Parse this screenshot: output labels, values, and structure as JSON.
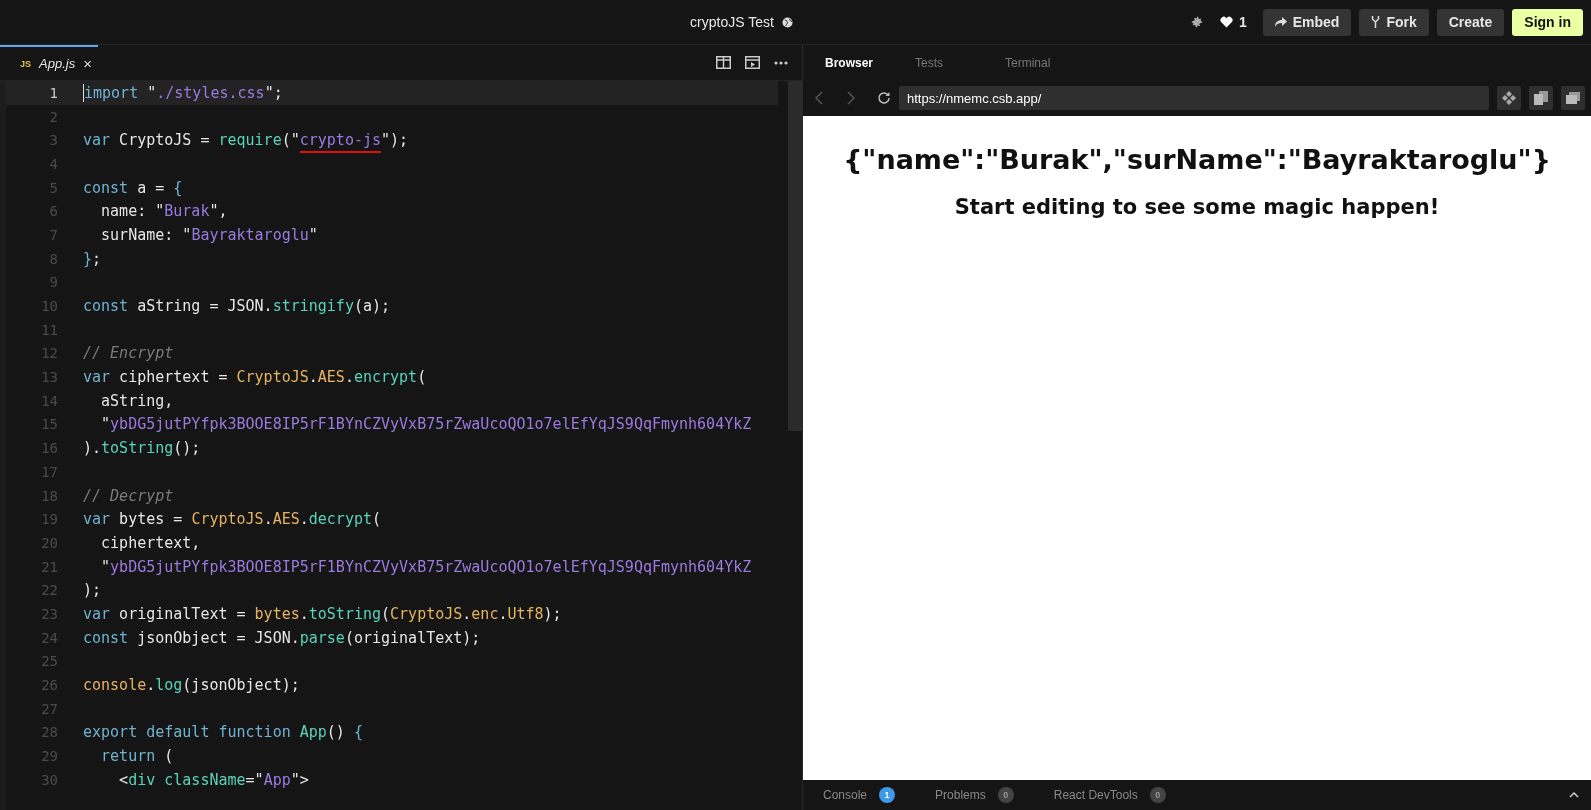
{
  "header": {
    "title": "cryptoJS Test",
    "likes": "1",
    "buttons": [
      {
        "label": "Embed",
        "kind": "share"
      },
      {
        "label": "Fork",
        "kind": "fork"
      },
      {
        "label": "Create",
        "kind": "plain"
      },
      {
        "label": "Sign in",
        "kind": "primary"
      }
    ]
  },
  "editor": {
    "tabs": [
      {
        "badge": "JS",
        "label": "App.js",
        "selected": true,
        "close": "×"
      }
    ],
    "lines": [
      {
        "number": "1",
        "active": true,
        "tokens": [
          {
            "kind": "kw",
            "text": "import"
          },
          {
            "kind": "p",
            "text": " \""
          },
          {
            "kind": "str",
            "text": "./styles.css"
          },
          {
            "kind": "p",
            "text": "\";"
          }
        ]
      },
      {
        "number": "2",
        "active": false
      },
      {
        "number": "3",
        "active": false,
        "tokens": [
          {
            "kind": "kw",
            "text": "var"
          },
          {
            "kind": "p",
            "text": " CryptoJS = "
          },
          {
            "kind": "fn",
            "text": "require"
          },
          {
            "kind": "p",
            "text": "(\""
          },
          {
            "kind": "err",
            "text": "crypto-js"
          },
          {
            "kind": "p",
            "text": "\");"
          }
        ]
      },
      {
        "number": "4",
        "active": false
      },
      {
        "number": "5",
        "active": false,
        "tokens": [
          {
            "kind": "kw",
            "text": "const"
          },
          {
            "kind": "p",
            "text": " a = "
          },
          {
            "kind": "kw",
            "text": "{"
          }
        ]
      },
      {
        "number": "6",
        "active": false,
        "tokens": [
          {
            "kind": "p",
            "text": "  name: \""
          },
          {
            "kind": "str",
            "text": "Burak"
          },
          {
            "kind": "p",
            "text": "\","
          }
        ]
      },
      {
        "number": "7",
        "active": false,
        "tokens": [
          {
            "kind": "p",
            "text": "  surName: \""
          },
          {
            "kind": "str",
            "text": "Bayraktaroglu"
          },
          {
            "kind": "p",
            "text": "\""
          }
        ]
      },
      {
        "number": "8",
        "active": false,
        "tokens": [
          {
            "kind": "kw",
            "text": "}"
          },
          {
            "kind": "p",
            "text": ";"
          }
        ]
      },
      {
        "number": "9",
        "active": false
      },
      {
        "number": "10",
        "active": false,
        "tokens": [
          {
            "kind": "kw",
            "text": "const"
          },
          {
            "kind": "p",
            "text": " aString = JSON."
          },
          {
            "kind": "fn",
            "text": "stringify"
          },
          {
            "kind": "p",
            "text": "(a);"
          }
        ]
      },
      {
        "number": "11",
        "active": false
      },
      {
        "number": "12",
        "active": false,
        "tokens": [
          {
            "kind": "cmt",
            "text": "// Encrypt"
          }
        ]
      },
      {
        "number": "13",
        "active": false,
        "tokens": [
          {
            "kind": "kw",
            "text": "var"
          },
          {
            "kind": "p",
            "text": " ciphertext = "
          },
          {
            "kind": "obj",
            "text": "CryptoJS"
          },
          {
            "kind": "p",
            "text": "."
          },
          {
            "kind": "obj",
            "text": "AES"
          },
          {
            "kind": "p",
            "text": "."
          },
          {
            "kind": "fn",
            "text": "encrypt"
          },
          {
            "kind": "p",
            "text": "("
          }
        ]
      },
      {
        "number": "14",
        "active": false,
        "tokens": [
          {
            "kind": "p",
            "text": "  aString,"
          }
        ]
      },
      {
        "number": "15",
        "active": false,
        "tokens": [
          {
            "kind": "p",
            "text": "  \""
          },
          {
            "kind": "str",
            "text": "ybDG5jutPYfpk3BOOE8IP5rF1BYnCZVyVxB75rZwaUcoQO1o7elEfYqJS9QqFmynh604YkZ"
          }
        ]
      },
      {
        "number": "16",
        "active": false,
        "tokens": [
          {
            "kind": "p",
            "text": ")."
          },
          {
            "kind": "fn",
            "text": "toString"
          },
          {
            "kind": "p",
            "text": "();"
          }
        ]
      },
      {
        "number": "17",
        "active": false
      },
      {
        "number": "18",
        "active": false,
        "tokens": [
          {
            "kind": "cmt",
            "text": "// Decrypt"
          }
        ]
      },
      {
        "number": "19",
        "active": false,
        "tokens": [
          {
            "kind": "kw",
            "text": "var"
          },
          {
            "kind": "p",
            "text": " bytes = "
          },
          {
            "kind": "obj",
            "text": "CryptoJS"
          },
          {
            "kind": "p",
            "text": "."
          },
          {
            "kind": "obj",
            "text": "AES"
          },
          {
            "kind": "p",
            "text": "."
          },
          {
            "kind": "fn",
            "text": "decrypt"
          },
          {
            "kind": "p",
            "text": "("
          }
        ]
      },
      {
        "number": "20",
        "active": false,
        "tokens": [
          {
            "kind": "p",
            "text": "  ciphertext,"
          }
        ]
      },
      {
        "number": "21",
        "active": false,
        "tokens": [
          {
            "kind": "p",
            "text": "  \""
          },
          {
            "kind": "str",
            "text": "ybDG5jutPYfpk3BOOE8IP5rF1BYnCZVyVxB75rZwaUcoQO1o7elEfYqJS9QqFmynh604YkZ"
          }
        ]
      },
      {
        "number": "22",
        "active": false,
        "tokens": [
          {
            "kind": "p",
            "text": ");"
          }
        ]
      },
      {
        "number": "23",
        "active": false,
        "tokens": [
          {
            "kind": "kw",
            "text": "var"
          },
          {
            "kind": "p",
            "text": " originalText = "
          },
          {
            "kind": "obj",
            "text": "bytes"
          },
          {
            "kind": "p",
            "text": "."
          },
          {
            "kind": "fn",
            "text": "toString"
          },
          {
            "kind": "p",
            "text": "("
          },
          {
            "kind": "obj",
            "text": "CryptoJS"
          },
          {
            "kind": "p",
            "text": "."
          },
          {
            "kind": "obj",
            "text": "enc"
          },
          {
            "kind": "p",
            "text": "."
          },
          {
            "kind": "obj",
            "text": "Utf8"
          },
          {
            "kind": "p",
            "text": ");"
          }
        ]
      },
      {
        "number": "24",
        "active": false,
        "tokens": [
          {
            "kind": "kw",
            "text": "const"
          },
          {
            "kind": "p",
            "text": " jsonObject = JSON."
          },
          {
            "kind": "fn",
            "text": "parse"
          },
          {
            "kind": "p",
            "text": "(originalText);"
          }
        ]
      },
      {
        "number": "25",
        "active": false
      },
      {
        "number": "26",
        "active": false,
        "tokens": [
          {
            "kind": "obj",
            "text": "console"
          },
          {
            "kind": "p",
            "text": "."
          },
          {
            "kind": "fn",
            "text": "log"
          },
          {
            "kind": "p",
            "text": "(jsonObject);"
          }
        ]
      },
      {
        "number": "27",
        "active": false
      },
      {
        "number": "28",
        "active": false,
        "tokens": [
          {
            "kind": "kw",
            "text": "export default function"
          },
          {
            "kind": "fn",
            "text": " App"
          },
          {
            "kind": "p",
            "text": "() "
          },
          {
            "kind": "kw",
            "text": "{"
          }
        ]
      },
      {
        "number": "29",
        "active": false,
        "tokens": [
          {
            "kind": "kw",
            "text": "  return"
          },
          {
            "kind": "p",
            "text": " ("
          }
        ]
      },
      {
        "number": "30",
        "active": false,
        "tokens": [
          {
            "kind": "p",
            "text": "    <"
          },
          {
            "kind": "fn",
            "text": "div"
          },
          {
            "kind": "fn",
            "text": " className"
          },
          {
            "kind": "p",
            "text": "=\""
          },
          {
            "kind": "str",
            "text": "App"
          },
          {
            "kind": "p",
            "text": "\">"
          }
        ]
      }
    ]
  },
  "preview": {
    "tabs": [
      {
        "label": "Browser",
        "selected": true
      },
      {
        "label": "Tests",
        "selected": false
      },
      {
        "label": "Terminal",
        "selected": false
      }
    ],
    "url": "https://nmemc.csb.app/",
    "heading": "{\"name\":\"Burak\",\"surName\":\"Bayraktaroglu\"}",
    "text": "Start editing to see some magic happen!",
    "bottom_tabs": [
      {
        "label": "Console",
        "count": "1",
        "highlighted": true
      },
      {
        "label": "Problems",
        "count": "0",
        "highlighted": false
      },
      {
        "label": "React DevTools",
        "count": "0",
        "highlighted": false
      }
    ]
  }
}
